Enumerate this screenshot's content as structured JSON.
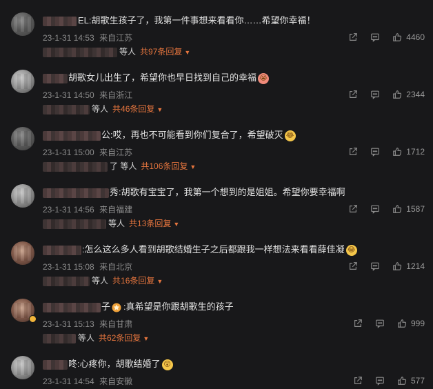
{
  "comments": [
    {
      "name_suffix": "EL",
      "text": ":胡歌生孩子了，我第一件事想来看看你……希望你幸福！",
      "time": "23-1-31 14:53",
      "location": "来自江苏",
      "likes": "4460",
      "replies_who": "等人",
      "replies_count": "共97条回复",
      "emoji": ""
    },
    {
      "name_suffix": "",
      "text": "胡歌女儿出生了，希望你也早日找到自己的幸福",
      "time": "23-1-31 14:50",
      "location": "来自浙江",
      "likes": "2344",
      "replies_who": "等人",
      "replies_count": "共46条回复",
      "emoji": "crying-face"
    },
    {
      "name_suffix": "公",
      "text": ":哎，再也不可能看到你们复合了，希望破灭",
      "time": "23-1-31 15:00",
      "location": "来自江苏",
      "likes": "1712",
      "replies_who": "了 等人",
      "replies_count": "共106条回复",
      "emoji": "laughing-tears-face"
    },
    {
      "name_suffix": "秀",
      "text": ":胡歌有宝宝了，我第一个想到的是姐姐。希望你要幸福啊",
      "time": "23-1-31 14:56",
      "location": "来自福建",
      "likes": "1587",
      "replies_who": "等人",
      "replies_count": "共13条回复",
      "emoji": ""
    },
    {
      "name_suffix": "",
      "text": ":怎么这么多人看到胡歌结婚生子之后都跟我一样想法来看看薛佳凝",
      "time": "23-1-31 15:08",
      "location": "来自北京",
      "likes": "1214",
      "replies_who": "等人",
      "replies_count": "共16条回复",
      "emoji": "laughing-tears-face"
    },
    {
      "name_suffix": "子",
      "text": ":真希望是你跟胡歌生的孩子",
      "time": "23-1-31 15:13",
      "location": "来自甘肃",
      "likes": "999",
      "replies_who": "等人",
      "replies_count": "共62条回复",
      "emoji": ""
    },
    {
      "name_suffix": "咚",
      "text": ":心疼你，胡歌结婚了",
      "time": "23-1-31 14:54",
      "location": "来自安徽",
      "likes": "577",
      "replies_who": "",
      "replies_count": "",
      "emoji": "surprised-face"
    }
  ],
  "colors": {
    "accent": "#e5753e",
    "background": "#18181a",
    "meta": "#8c8c8c"
  },
  "icons": {
    "share": "share-icon",
    "comment": "comment-icon",
    "like": "thumbs-up-icon"
  }
}
